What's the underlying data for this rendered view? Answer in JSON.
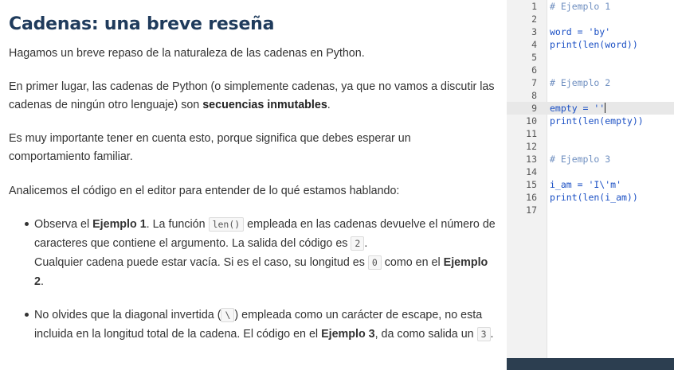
{
  "lesson": {
    "title": "Cadenas: una breve reseña",
    "p1": "Hagamos un breve repaso de la naturaleza de las cadenas en Python.",
    "p2_a": "En primer lugar, las cadenas de Python (o simplemente cadenas, ya que no vamos a discutir las cadenas de ningún otro lenguaje) son ",
    "p2_b": "secuencias inmutables",
    "p2_c": ".",
    "p3": "Es muy importante tener en cuenta esto, porque significa que debes esperar un comportamiento familiar.",
    "p4": "Analicemos el código en el editor para entender de lo qué estamos hablando:",
    "b1": {
      "t1": "Observa el ",
      "t2": "Ejemplo 1",
      "t3": ". La función ",
      "code1": "len()",
      "t4": " empleada en las cadenas devuelve el número de caracteres que contiene el argumento. La salida del código es ",
      "code2": "2",
      "t5": ".",
      "t6": "Cualquier cadena puede estar vacía. Si es el caso, su longitud es ",
      "code3": "0",
      "t7": " como en el ",
      "t8": "Ejemplo 2",
      "t9": "."
    },
    "b2": {
      "t1": "No olvides que la diagonal invertida (",
      "code1": "\\",
      "t2": ") empleada como un carácter de escape, no esta incluida en la longitud total de la cadena. El código en el ",
      "t3": "Ejemplo 3",
      "t4": ", da como salida un ",
      "code2": "3",
      "t5": "."
    }
  },
  "editor": {
    "active_line": 9,
    "lines": [
      {
        "n": "1",
        "code": "# Ejemplo 1"
      },
      {
        "n": "2",
        "code": ""
      },
      {
        "n": "3",
        "code": "word = 'by'"
      },
      {
        "n": "4",
        "code": "print(len(word))"
      },
      {
        "n": "5",
        "code": ""
      },
      {
        "n": "6",
        "code": ""
      },
      {
        "n": "7",
        "code": "# Ejemplo 2"
      },
      {
        "n": "8",
        "code": ""
      },
      {
        "n": "9",
        "code": "empty = ''"
      },
      {
        "n": "10",
        "code": "print(len(empty))"
      },
      {
        "n": "11",
        "code": ""
      },
      {
        "n": "12",
        "code": ""
      },
      {
        "n": "13",
        "code": "# Ejemplo 3"
      },
      {
        "n": "14",
        "code": ""
      },
      {
        "n": "15",
        "code": "i_am = 'I\\'m'"
      },
      {
        "n": "16",
        "code": "print(len(i_am))"
      },
      {
        "n": "17",
        "code": ""
      }
    ]
  }
}
